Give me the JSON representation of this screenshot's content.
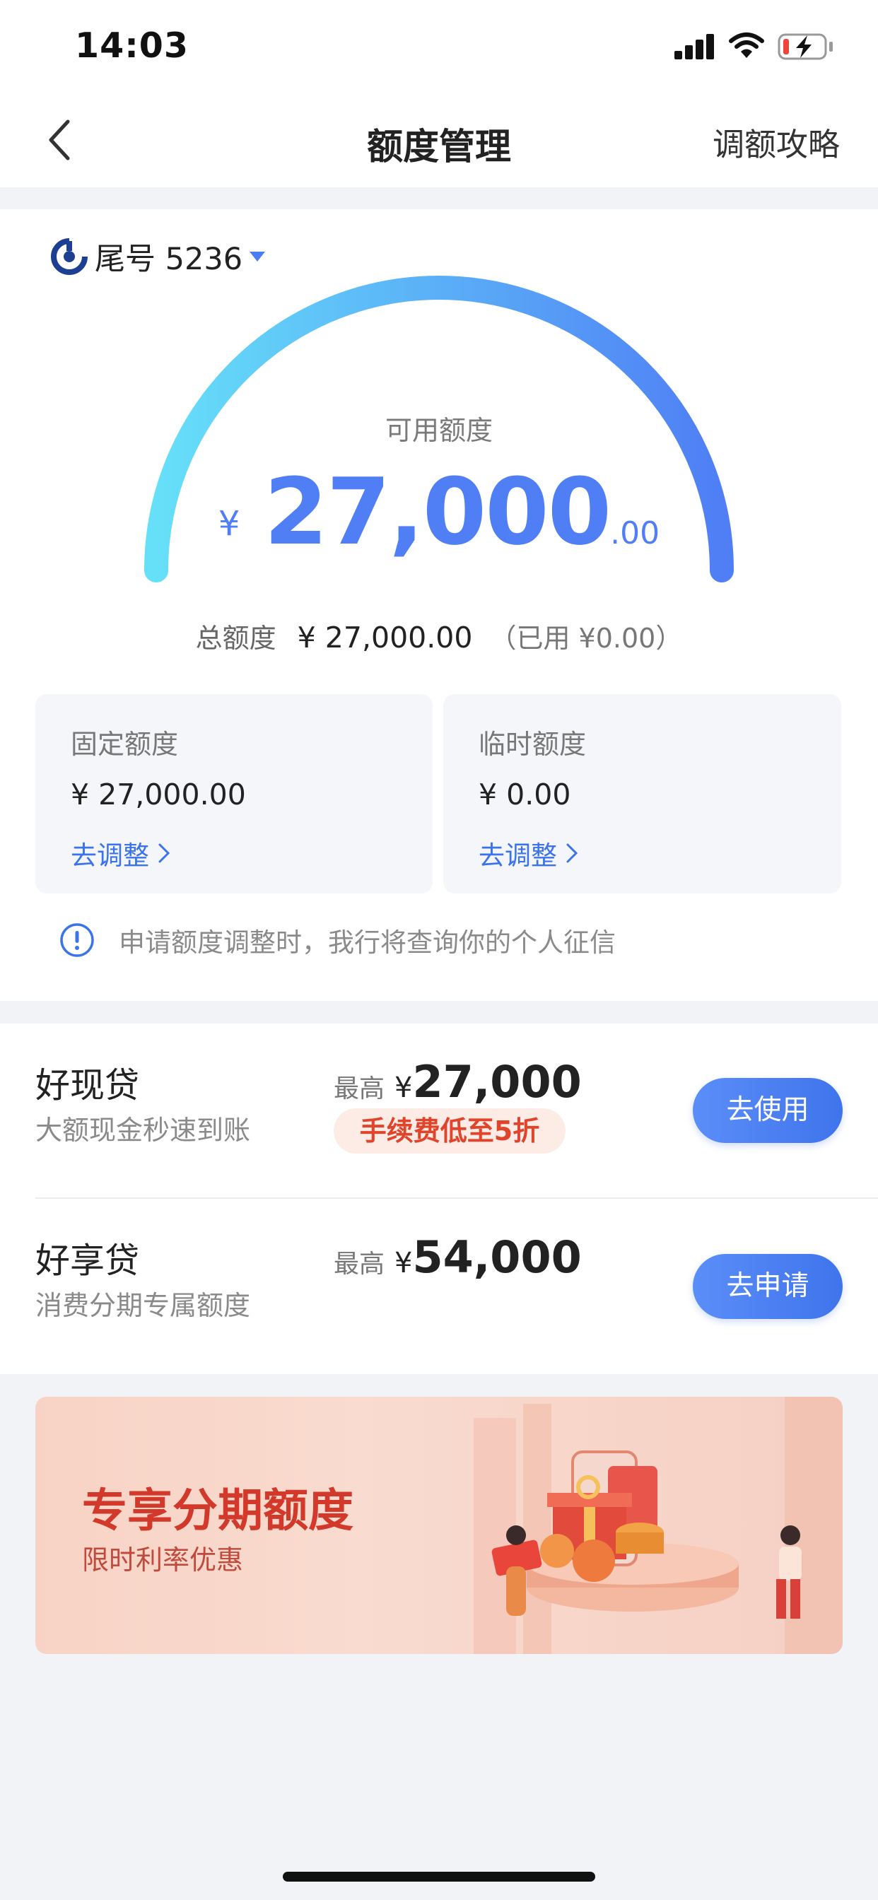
{
  "status_bar": {
    "time": "14:03"
  },
  "nav": {
    "title": "额度管理",
    "right_link": "调额攻略"
  },
  "card": {
    "tail_label": "尾号 5236"
  },
  "available": {
    "label": "可用额度",
    "currency": "¥",
    "integer_part": "27,000",
    "decimal_part": ".00",
    "gauge_fraction": 1.0
  },
  "total": {
    "label": "总额度",
    "value": "¥ 27,000.00",
    "used": "（已用 ¥0.00）"
  },
  "quotas": [
    {
      "title": "固定额度",
      "value": "¥ 27,000.00",
      "link": "去调整"
    },
    {
      "title": "临时额度",
      "value": "¥ 0.00",
      "link": "去调整"
    }
  ],
  "notice": {
    "text": "申请额度调整时，我行将查询你的个人征信"
  },
  "loans": [
    {
      "name": "好现贷",
      "desc": "大额现金秒速到账",
      "max_label": "最高",
      "currency": "¥",
      "max_amount": "27,000",
      "badge": "手续费低至5折",
      "button": "去使用"
    },
    {
      "name": "好享贷",
      "desc": "消费分期专属额度",
      "max_label": "最高",
      "currency": "¥",
      "max_amount": "54,000",
      "button": "去申请"
    }
  ],
  "banner": {
    "title": "专享分期额度",
    "subtitle": "限时利率优惠"
  },
  "colors": {
    "accent": "#4f7ef5",
    "gauge_start": "#66e0f9",
    "gauge_end": "#4f7ef5",
    "promo_red": "#d2392a"
  },
  "icons": [
    "back-chevron-icon",
    "bank-logo-icon",
    "dropdown-caret-icon",
    "info-icon",
    "chevron-right-icon",
    "signal-icon",
    "wifi-icon",
    "battery-charging-icon"
  ]
}
